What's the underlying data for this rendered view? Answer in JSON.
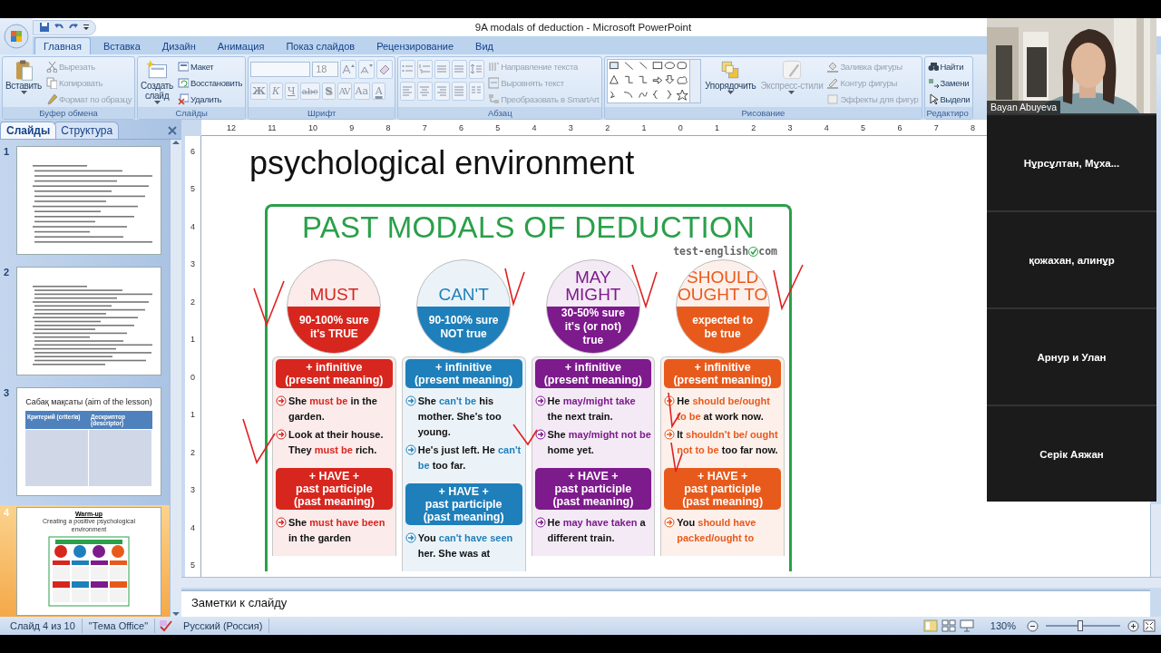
{
  "window": {
    "title": "9A modals of deduction - Microsoft PowerPoint"
  },
  "ribbon_tabs": [
    {
      "label": "Главная",
      "selected": true
    },
    {
      "label": "Вставка",
      "selected": false
    },
    {
      "label": "Дизайн",
      "selected": false
    },
    {
      "label": "Анимация",
      "selected": false
    },
    {
      "label": "Показ слайдов",
      "selected": false
    },
    {
      "label": "Рецензирование",
      "selected": false
    },
    {
      "label": "Вид",
      "selected": false
    }
  ],
  "ribbon_groups": [
    {
      "kind": "clipboard",
      "label": "Буфер обмена",
      "big_buttons": [
        {
          "label": "Вставить",
          "disabled": false
        }
      ],
      "items": [
        {
          "label": "Вырезать",
          "disabled": true
        },
        {
          "label": "Копировать",
          "disabled": true
        },
        {
          "label": "Формат по образцу",
          "disabled": true
        }
      ]
    },
    {
      "kind": "slides",
      "label": "Слайды",
      "big_buttons": [
        {
          "label": "Создать слайд",
          "disabled": false
        }
      ],
      "items": [
        {
          "label": "Макет",
          "disabled": false
        },
        {
          "label": "Восстановить",
          "disabled": false
        },
        {
          "label": "Удалить",
          "disabled": false
        }
      ]
    },
    {
      "kind": "font",
      "label": "Шрифт",
      "font_size": "18",
      "format_buttons": [
        {
          "label": "Ж",
          "kind": "bold"
        },
        {
          "label": "К",
          "kind": "italic"
        },
        {
          "label": "Ч",
          "kind": "underline"
        },
        {
          "label": "abc",
          "kind": "strike"
        },
        {
          "label": "S",
          "kind": "shadow"
        },
        {
          "label": "AV",
          "kind": "spacing"
        },
        {
          "label": "Aa",
          "kind": "case"
        },
        {
          "label": "A",
          "kind": "color"
        }
      ]
    },
    {
      "kind": "paragraph",
      "label": "Абзац",
      "items": [
        {
          "label": "Направление текста",
          "disabled": true
        },
        {
          "label": "Выровнять текст",
          "disabled": true
        },
        {
          "label": "Преобразовать в SmartArt",
          "disabled": true
        }
      ]
    },
    {
      "kind": "drawing",
      "label": "Рисование",
      "big_buttons": [
        {
          "label": "Упорядочить",
          "disabled": false
        },
        {
          "label": "Экспресс-стили",
          "disabled": true
        }
      ],
      "items": [
        {
          "label": "Заливка фигуры",
          "disabled": true
        },
        {
          "label": "Контур фигуры",
          "disabled": true
        },
        {
          "label": "Эффекты для фигур",
          "disabled": true
        }
      ]
    },
    {
      "kind": "editing",
      "label": "Редактиро",
      "items": [
        {
          "label": "Найти",
          "disabled": false
        },
        {
          "label": "Замени",
          "disabled": false
        },
        {
          "label": "Выдели",
          "disabled": false
        }
      ]
    }
  ],
  "side_pane": {
    "tabs": [
      {
        "label": "Слайды",
        "selected": true
      },
      {
        "label": "Структура",
        "selected": false
      }
    ],
    "thumbnails": [
      {
        "number": "1",
        "kind": "document",
        "selected": false
      },
      {
        "number": "2",
        "kind": "document",
        "selected": false
      },
      {
        "number": "3",
        "kind": "table",
        "selected": false,
        "title": "Сабақ мақсаты (aim of the lesson)",
        "columns": [
          "Критерий  (criteria)",
          "Дескриптор (descriptor)"
        ]
      },
      {
        "number": "4",
        "kind": "warmup",
        "selected": true,
        "title": "Warm-up",
        "subtitle": "Creating a positive psychological environment"
      }
    ]
  },
  "ruler": {
    "horizontal": [
      "12",
      "11",
      "10",
      "9",
      "8",
      "7",
      "6",
      "5",
      "4",
      "3",
      "2",
      "1",
      "0",
      "1",
      "2",
      "3",
      "4",
      "5",
      "6",
      "7",
      "8"
    ],
    "vertical": [
      "6",
      "5",
      "4",
      "3",
      "2",
      "1",
      "0",
      "1",
      "2",
      "3",
      "4",
      "5"
    ]
  },
  "slide": {
    "heading": "psychological environment",
    "infographic": {
      "title": "PAST MODALS OF DEDUCTION",
      "source": [
        "test-english",
        "com"
      ],
      "columns": [
        {
          "color": "#d7261e",
          "name": [
            "MUST"
          ],
          "certainty": [
            "90-100% sure",
            "it's TRUE"
          ],
          "sections": [
            {
              "header": [
                "+ infinitive",
                "(present meaning)"
              ],
              "sentences": [
                [
                  "She ",
                  "must be",
                  " in the garden."
                ],
                [
                  "Look at their house. They ",
                  "must be",
                  " rich."
                ]
              ]
            },
            {
              "header": [
                "+ HAVE +",
                "past participle",
                "(past meaning)"
              ],
              "sentences": [
                [
                  "She ",
                  "must have been",
                  " in the garden"
                ]
              ]
            }
          ]
        },
        {
          "color": "#1f7fba",
          "name": [
            "CAN'T"
          ],
          "certainty": [
            "90-100% sure",
            "NOT true"
          ],
          "sections": [
            {
              "header": [
                "+ infinitive",
                "(present meaning)"
              ],
              "sentences": [
                [
                  "She ",
                  "can't be",
                  " his mother. She's too young."
                ],
                [
                  "He's just left. He ",
                  "can't be",
                  " too far."
                ]
              ]
            },
            {
              "header": [
                "+ HAVE +",
                "past participle",
                "(past meaning)"
              ],
              "sentences": [
                [
                  "You ",
                  "can't have seen",
                  " her. She was at"
                ]
              ]
            }
          ]
        },
        {
          "color": "#7d1a8c",
          "name": [
            "MAY",
            "MIGHT"
          ],
          "certainty": [
            "30-50% sure",
            "it's (or not)",
            "true"
          ],
          "sections": [
            {
              "header": [
                "+ infinitive",
                "(present meaning)"
              ],
              "sentences": [
                [
                  "He ",
                  "may/might take",
                  " the next train."
                ],
                [
                  "She ",
                  "may/might not be",
                  " home yet."
                ]
              ]
            },
            {
              "header": [
                "+ HAVE +",
                "past participle",
                "(past meaning)"
              ],
              "sentences": [
                [
                  "He ",
                  "may have taken",
                  " a different train."
                ]
              ]
            }
          ]
        },
        {
          "color": "#e85a1c",
          "name": [
            "SHOULD",
            "OUGHT TO"
          ],
          "certainty": [
            "expected to",
            "be true"
          ],
          "sections": [
            {
              "header": [
                "+ infinitive",
                "(present meaning)"
              ],
              "sentences": [
                [
                  "He ",
                  "should be/ought to be",
                  " at work now."
                ],
                [
                  "It ",
                  "shouldn't be/ ought not to be",
                  " too far now."
                ]
              ]
            },
            {
              "header": [
                "+ HAVE +",
                "past participle",
                "(past meaning)"
              ],
              "sentences": [
                [
                  "You ",
                  "should have packed/ought to"
                ]
              ]
            }
          ]
        }
      ]
    }
  },
  "notes": {
    "text": "Заметки к слайду"
  },
  "status_bar": {
    "slide": "Слайд 4 из 10",
    "theme": "\"Тема Office\"",
    "language": "Русский (Россия)",
    "zoom": "130%",
    "zoom_slider": {
      "level": 0.46
    }
  },
  "call": {
    "speaker": {
      "name": "Bayan Abuyeva",
      "kind": "picture"
    },
    "participants": [
      "Нұрсұлтан, Мұха...",
      "қожахан, алинұр",
      "Арнур и Улан",
      "Серік Аяжан"
    ]
  }
}
